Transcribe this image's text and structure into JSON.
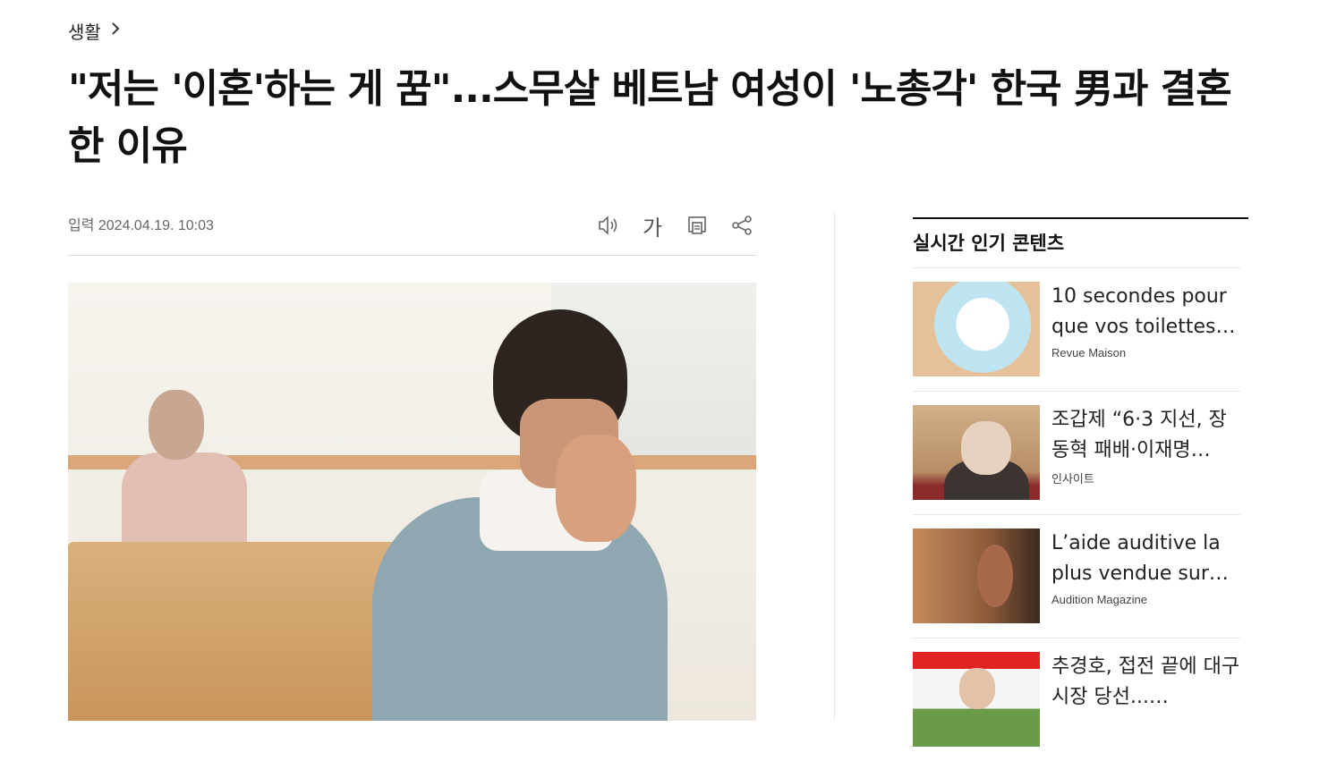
{
  "breadcrumb": {
    "label": "생활",
    "chevron": "chevron-right-icon"
  },
  "article": {
    "title": "\"저는 '이혼'하는 게 꿈\"...스무살 베트남 여성이 '노총각' 한국 男과 결혼한 이유",
    "meta": "입력 2024.04.19. 10:03",
    "tools": {
      "audio": "speaker-icon",
      "font_label": "가",
      "print": "print-icon",
      "share": "share-icon"
    }
  },
  "sidebar": {
    "title": "실시간 인기 콘텐츠",
    "items": [
      {
        "title": "10 secondes pour que vos toilettes…",
        "source": "Revue Maison"
      },
      {
        "title": "조갑제 “6·3 지선, 장동혁 패배·이재명…",
        "source": "인사이트"
      },
      {
        "title": "L’aide auditive la plus vendue sur…",
        "source": "Audition Magazine"
      },
      {
        "title": "추경호, 접전 끝에 대구시장 당선...…",
        "source": ""
      }
    ]
  }
}
